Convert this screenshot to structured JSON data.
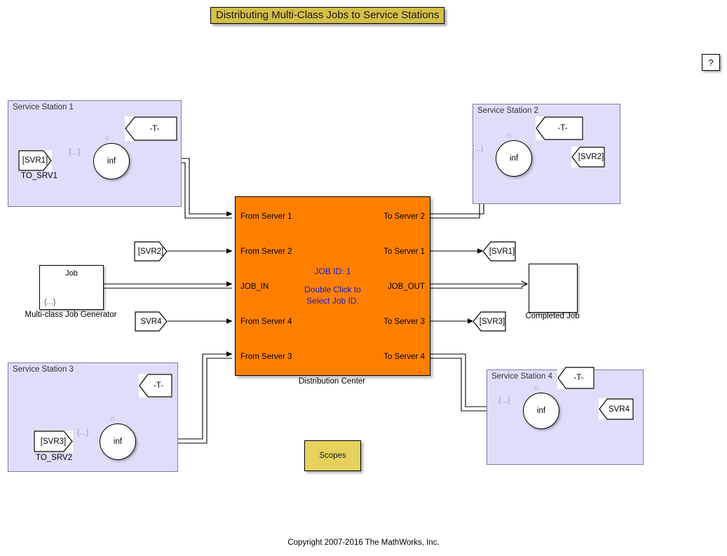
{
  "title_annotation": "Distributing Multi-Class Jobs to Service Stations",
  "help_button": "?",
  "copyright": "Copyright 2007-2016 The MathWorks, Inc.",
  "colors": {
    "title_bg": "#d4bf48",
    "subsystem_bg": "#dedefa",
    "distribution_center_bg": "#ff8000",
    "distribution_center_text": "#1a1ad0",
    "scopes_bg": "#e5d15c",
    "wire": "#000000"
  },
  "distribution_center": {
    "caption": "Distribution Center",
    "center_text_line1": "JOB ID: 1",
    "center_text_line2": "Double Click to",
    "center_text_line3": "Select Job ID.",
    "input_ports": [
      {
        "label": "From Server 1"
      },
      {
        "label": "From Server 2"
      },
      {
        "label": "JOB_IN"
      },
      {
        "label": "From Server 4"
      },
      {
        "label": "From Server 3"
      }
    ],
    "output_ports": [
      {
        "label": "To Server 2"
      },
      {
        "label": "To Server 1"
      },
      {
        "label": "JOB_OUT"
      },
      {
        "label": "To Server 3"
      },
      {
        "label": "To Server 4"
      }
    ]
  },
  "service_stations": [
    {
      "title": "Service Station 1",
      "server_label": "inf",
      "brace_label": "{...}",
      "n_label": "n",
      "scope_label": "-T-",
      "tag_label": "[SVR1]",
      "tag_caption": "TO_SRV1"
    },
    {
      "title": "Service Station 2",
      "server_label": "inf",
      "brace_label": "{...}",
      "n_label": "n",
      "scope_label": "-T-",
      "tag_label": "[SVR2]",
      "tag_caption": ""
    },
    {
      "title": "Service Station 3",
      "server_label": "inf",
      "brace_label": "{...}",
      "n_label": "n",
      "scope_label": "-T-",
      "tag_label": "[SVR3]",
      "tag_caption": "TO_SRV2"
    },
    {
      "title": "Service Station 4",
      "server_label": "inf",
      "brace_label": "{...}",
      "n_label": "n",
      "scope_label": "-T-",
      "tag_label": "SVR4",
      "tag_caption": ""
    }
  ],
  "job_generator": {
    "top_label": "Job",
    "corner_label": "{...}",
    "caption": "Multi-class Job Generator"
  },
  "completed_job": {
    "caption": "Completed Job"
  },
  "scopes_button": {
    "label": "Scopes"
  },
  "standalone_tags": [
    {
      "name": "from-svr2",
      "label": "[SVR2]"
    },
    {
      "name": "from-svr4",
      "label": "SVR4"
    },
    {
      "name": "goto-svr1",
      "label": "[SVR1]"
    },
    {
      "name": "goto-svr3",
      "label": "[SVR3]"
    }
  ]
}
